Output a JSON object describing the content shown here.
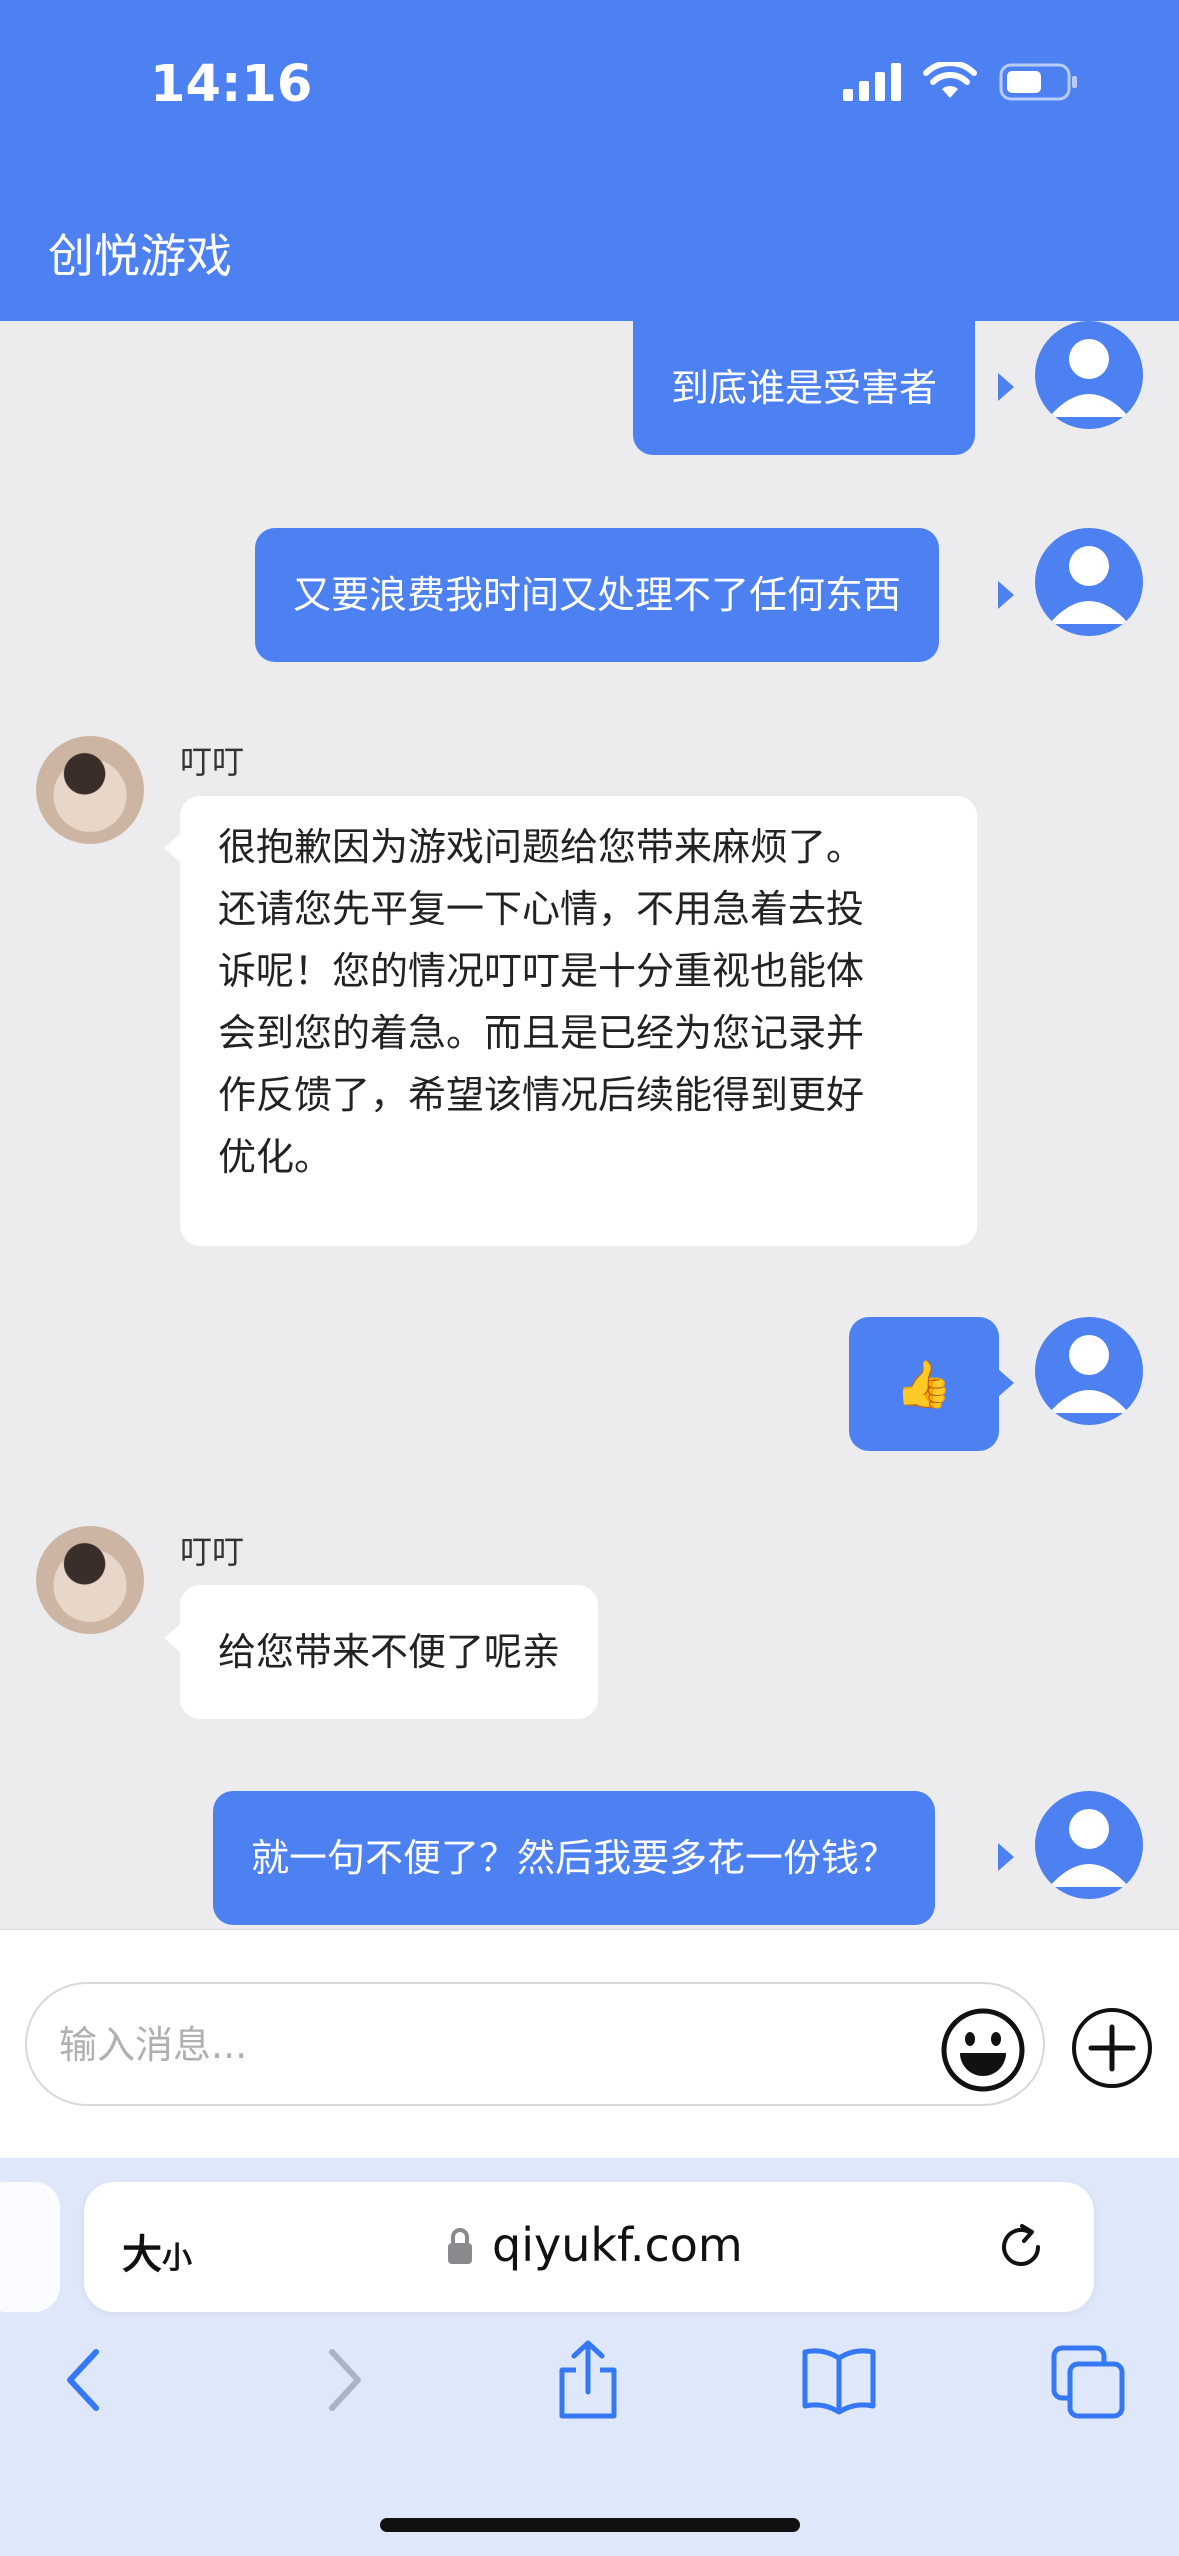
{
  "status_bar": {
    "time": "14:16"
  },
  "header": {
    "title": "创悦游戏"
  },
  "messages": [
    {
      "from": "user",
      "text": "到底谁是受害者"
    },
    {
      "from": "user",
      "text": "又要浪费我时间又处理不了任何东西"
    },
    {
      "from": "agent",
      "sender": "叮叮",
      "lines": [
        "很抱歉因为游戏问题给您带来麻烦了。",
        "还请您先平复一下心情，不用急着去投",
        "诉呢！您的情况叮叮是十分重视也能体",
        "会到您的着急。而且是已经为您记录并",
        "作反馈了，希望该情况后续能得到更好",
        "优化。"
      ]
    },
    {
      "from": "user",
      "text": "👍"
    },
    {
      "from": "agent",
      "sender": "叮叮",
      "text": "给您带来不便了呢亲"
    },
    {
      "from": "user",
      "text": "就一句不便了？然后我要多花一份钱？"
    }
  ],
  "composer": {
    "placeholder": "输入消息..."
  },
  "browser": {
    "text_size_big": "大",
    "text_size_small": "小",
    "url": "qiyukf.com"
  },
  "colors": {
    "accent": "#4d80f0",
    "chat_bg": "#ececef"
  }
}
